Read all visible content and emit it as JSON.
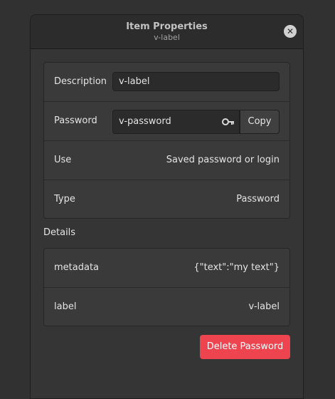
{
  "header": {
    "title": "Item Properties",
    "subtitle": "v-label",
    "close_icon": "close-icon"
  },
  "properties": {
    "description_label": "Description",
    "description_value": "v-label",
    "password_label": "Password",
    "password_value": "v-password",
    "password_icon": "key-icon",
    "copy_label": "Copy",
    "use_label": "Use",
    "use_value": "Saved password or login",
    "type_label": "Type",
    "type_value": "Password"
  },
  "details": {
    "heading": "Details",
    "rows": [
      {
        "key": "metadata",
        "value": "{\"text\":\"my text\"}"
      },
      {
        "key": "label",
        "value": "v-label"
      }
    ]
  },
  "actions": {
    "delete_label": "Delete Password",
    "delete_color": "#ee4450"
  }
}
